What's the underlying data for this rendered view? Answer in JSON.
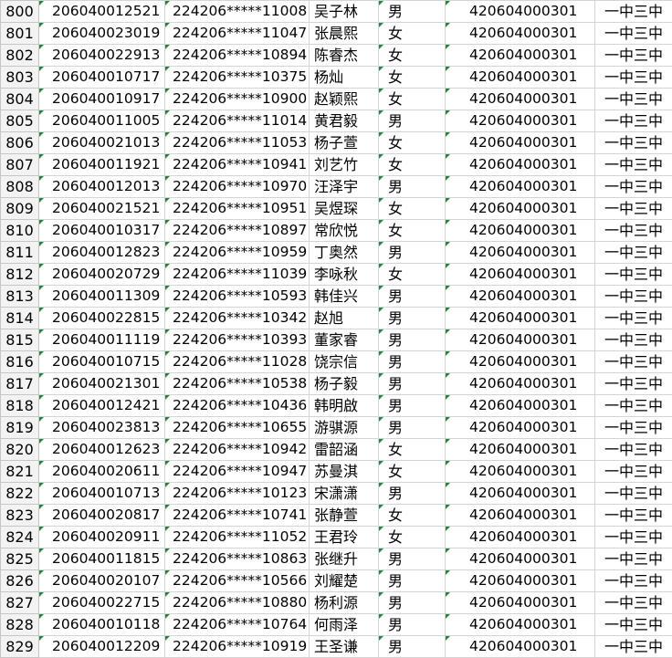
{
  "sheet": {
    "rows": [
      {
        "num": "800",
        "id": "206040012521",
        "idno": "224206*****11008",
        "name": "吴子林",
        "gender": "男",
        "code": "420604000301",
        "school": "一中三中"
      },
      {
        "num": "801",
        "id": "206040023019",
        "idno": "224206*****11047",
        "name": "张晨熙",
        "gender": "女",
        "code": "420604000301",
        "school": "一中三中"
      },
      {
        "num": "802",
        "id": "206040022913",
        "idno": "224206*****10894",
        "name": "陈睿杰",
        "gender": "女",
        "code": "420604000301",
        "school": "一中三中"
      },
      {
        "num": "803",
        "id": "206040010717",
        "idno": "224206*****10375",
        "name": "杨灿",
        "gender": "女",
        "code": "420604000301",
        "school": "一中三中"
      },
      {
        "num": "804",
        "id": "206040010917",
        "idno": "224206*****10900",
        "name": "赵颖熙",
        "gender": "女",
        "code": "420604000301",
        "school": "一中三中"
      },
      {
        "num": "805",
        "id": "206040011005",
        "idno": "224206*****11014",
        "name": "黄君毅",
        "gender": "男",
        "code": "420604000301",
        "school": "一中三中"
      },
      {
        "num": "806",
        "id": "206040021013",
        "idno": "224206*****11053",
        "name": "杨子萱",
        "gender": "女",
        "code": "420604000301",
        "school": "一中三中"
      },
      {
        "num": "807",
        "id": "206040011921",
        "idno": "224206*****10941",
        "name": "刘艺竹",
        "gender": "女",
        "code": "420604000301",
        "school": "一中三中"
      },
      {
        "num": "808",
        "id": "206040012013",
        "idno": "224206*****10970",
        "name": "汪泽宇",
        "gender": "男",
        "code": "420604000301",
        "school": "一中三中"
      },
      {
        "num": "809",
        "id": "206040021521",
        "idno": "224206*****10951",
        "name": "吴煜琛",
        "gender": "女",
        "code": "420604000301",
        "school": "一中三中"
      },
      {
        "num": "810",
        "id": "206040010317",
        "idno": "224206*****10897",
        "name": "常欣悦",
        "gender": "女",
        "code": "420604000301",
        "school": "一中三中"
      },
      {
        "num": "811",
        "id": "206040012823",
        "idno": "224206*****10959",
        "name": "丁奥然",
        "gender": "男",
        "code": "420604000301",
        "school": "一中三中"
      },
      {
        "num": "812",
        "id": "206040020729",
        "idno": "224206*****11039",
        "name": "李咏秋",
        "gender": "女",
        "code": "420604000301",
        "school": "一中三中"
      },
      {
        "num": "813",
        "id": "206040011309",
        "idno": "224206*****10593",
        "name": "韩佳兴",
        "gender": "男",
        "code": "420604000301",
        "school": "一中三中"
      },
      {
        "num": "814",
        "id": "206040022815",
        "idno": "224206*****10342",
        "name": "赵旭",
        "gender": "男",
        "code": "420604000301",
        "school": "一中三中"
      },
      {
        "num": "815",
        "id": "206040011119",
        "idno": "224206*****10393",
        "name": "董家睿",
        "gender": "男",
        "code": "420604000301",
        "school": "一中三中"
      },
      {
        "num": "816",
        "id": "206040010715",
        "idno": "224206*****11028",
        "name": "饶宗信",
        "gender": "男",
        "code": "420604000301",
        "school": "一中三中"
      },
      {
        "num": "817",
        "id": "206040021301",
        "idno": "224206*****10538",
        "name": "杨子毅",
        "gender": "男",
        "code": "420604000301",
        "school": "一中三中"
      },
      {
        "num": "818",
        "id": "206040012421",
        "idno": "224206*****10436",
        "name": "韩明啟",
        "gender": "男",
        "code": "420604000301",
        "school": "一中三中"
      },
      {
        "num": "819",
        "id": "206040023813",
        "idno": "224206*****10655",
        "name": "游骐源",
        "gender": "男",
        "code": "420604000301",
        "school": "一中三中"
      },
      {
        "num": "820",
        "id": "206040012623",
        "idno": "224206*****10942",
        "name": "雷韶涵",
        "gender": "女",
        "code": "420604000301",
        "school": "一中三中"
      },
      {
        "num": "821",
        "id": "206040020611",
        "idno": "224206*****10947",
        "name": "苏曼淇",
        "gender": "女",
        "code": "420604000301",
        "school": "一中三中"
      },
      {
        "num": "822",
        "id": "206040010713",
        "idno": "224206*****10123",
        "name": "宋潇潇",
        "gender": "男",
        "code": "420604000301",
        "school": "一中三中"
      },
      {
        "num": "823",
        "id": "206040020817",
        "idno": "224206*****10741",
        "name": "张静萱",
        "gender": "女",
        "code": "420604000301",
        "school": "一中三中"
      },
      {
        "num": "824",
        "id": "206040020911",
        "idno": "224206*****11052",
        "name": "王君玲",
        "gender": "女",
        "code": "420604000301",
        "school": "一中三中"
      },
      {
        "num": "825",
        "id": "206040011815",
        "idno": "224206*****10863",
        "name": "张继升",
        "gender": "男",
        "code": "420604000301",
        "school": "一中三中"
      },
      {
        "num": "826",
        "id": "206040020107",
        "idno": "224206*****10566",
        "name": "刘耀楚",
        "gender": "男",
        "code": "420604000301",
        "school": "一中三中"
      },
      {
        "num": "827",
        "id": "206040022715",
        "idno": "224206*****10880",
        "name": "杨利源",
        "gender": "男",
        "code": "420604000301",
        "school": "一中三中"
      },
      {
        "num": "828",
        "id": "206040010118",
        "idno": "224206*****10764",
        "name": "何雨泽",
        "gender": "男",
        "code": "420604000301",
        "school": "一中三中"
      },
      {
        "num": "829",
        "id": "206040012209",
        "idno": "224206*****10919",
        "name": "王圣谦",
        "gender": "男",
        "code": "420604000301",
        "school": "一中三中"
      }
    ]
  }
}
